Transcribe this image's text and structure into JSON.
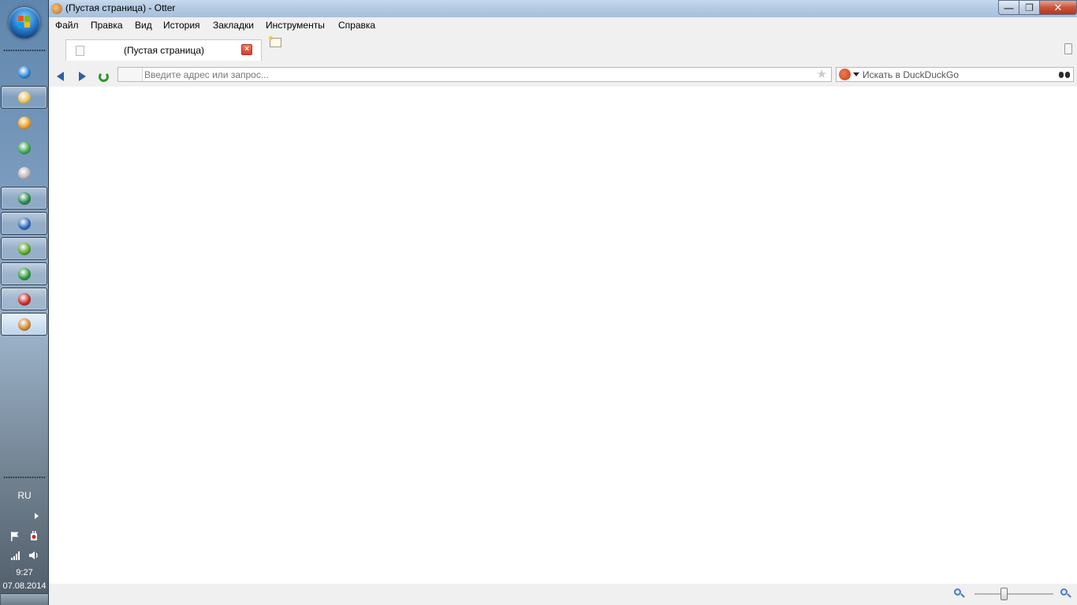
{
  "window": {
    "title": "(Пустая страница) - Otter"
  },
  "menu": [
    "Файл",
    "Правка",
    "Вид",
    "История",
    "Закладки",
    "Инструменты",
    "Справка"
  ],
  "tabs": [
    {
      "title": "(Пустая страница)"
    }
  ],
  "address_bar": {
    "placeholder": "Введите адрес или запрос...",
    "value": ""
  },
  "search_bar": {
    "placeholder": "Искать в DuckDuckGo",
    "engine_icon": "duckduckgo-icon"
  },
  "taskbar": {
    "pinned": [
      {
        "name": "internet-explorer-icon",
        "framed": false,
        "color": "#2f86d6"
      },
      {
        "name": "file-explorer-icon",
        "framed": true,
        "color": "#e8c35a"
      },
      {
        "name": "media-player-icon",
        "framed": false,
        "color": "#f0a020"
      },
      {
        "name": "chrome-icon",
        "framed": false,
        "color": "#3aa853"
      },
      {
        "name": "satellite-icon",
        "framed": false,
        "color": "#b8b8b8"
      },
      {
        "name": "network-monitor-icon",
        "framed": true,
        "color": "#2a8a4a"
      },
      {
        "name": "globe-app-icon",
        "framed": true,
        "color": "#2d6cc0"
      },
      {
        "name": "utorrent-icon",
        "framed": true,
        "color": "#5aa82a"
      },
      {
        "name": "search-app-icon",
        "framed": true,
        "color": "#2a9a3a"
      },
      {
        "name": "pdf-reader-icon",
        "framed": true,
        "color": "#c8302a"
      },
      {
        "name": "otter-browser-icon",
        "framed": true,
        "active": true,
        "color": "#d08a30"
      }
    ],
    "language": "RU",
    "time": "9:27",
    "date": "07.08.2014"
  },
  "colors": {
    "accent": "#2d5ea8",
    "reload": "#2e9a2e",
    "close": "#d5412a"
  }
}
